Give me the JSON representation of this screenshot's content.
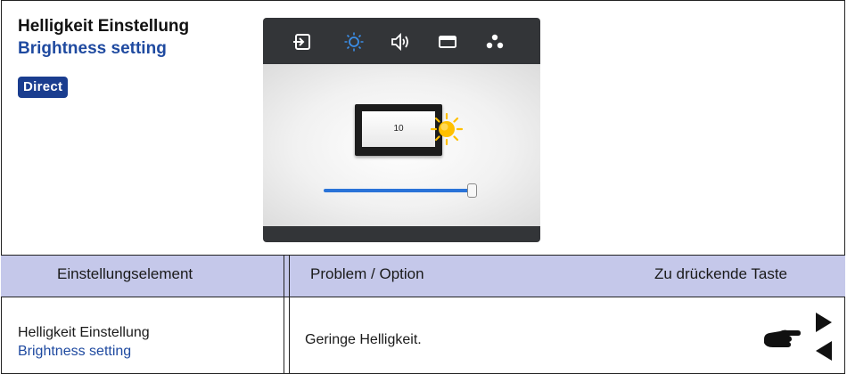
{
  "header": {
    "title": "Helligkeit Einstellung",
    "subtitle": "Brightness setting",
    "badge": "Direct"
  },
  "osd": {
    "menu_icons": [
      "input-icon",
      "brightness-icon",
      "volume-icon",
      "display-icon",
      "color-icon"
    ],
    "selected_icon": "brightness-icon",
    "brightness_value": "10",
    "slider_level": 1.0,
    "accent_color": "#2a73d8"
  },
  "table": {
    "headers": [
      "Einstellungselement",
      "Problem / Option",
      "Zu drückende Taste"
    ],
    "rows": [
      {
        "item": "Helligkeit Einstellung",
        "item_en": "Brightness setting",
        "option": "Geringe  Helligkeit.",
        "keys": [
          "pointing-hand-icon",
          "right-arrow-icon",
          "left-arrow-icon"
        ]
      }
    ],
    "header_color": "#c5c8ea"
  }
}
